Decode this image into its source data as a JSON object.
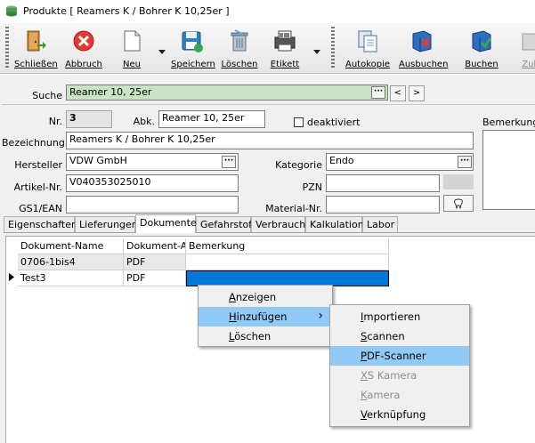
{
  "window": {
    "title": "Produkte [ Reamers K / Bohrer K 10,25er ]"
  },
  "toolbar": {
    "items": [
      {
        "label": "Schließen",
        "icon": "door-exit-icon"
      },
      {
        "label": "Abbruch",
        "icon": "cancel-icon"
      },
      {
        "label": "Neu",
        "icon": "new-document-icon"
      },
      {
        "label": "Speichern",
        "icon": "save-icon"
      },
      {
        "label": "Löschen",
        "icon": "trash-icon"
      },
      {
        "label": "Etikett",
        "icon": "label-printer-icon"
      },
      {
        "label": "Autokopie",
        "icon": "copy-icon"
      },
      {
        "label": "Ausbuchen",
        "icon": "book-out-icon"
      },
      {
        "label": "Buchen",
        "icon": "book-in-icon"
      },
      {
        "label": "Zub",
        "icon": "accessories-icon"
      }
    ]
  },
  "form": {
    "search_label": "Suche",
    "search_value": "Reamer 10, 25er",
    "nr_label": "Nr.",
    "nr_value": "3",
    "abk_label": "Abk.",
    "abk_value": "Reamer 10, 25er",
    "deaktiviert_label": "deaktiviert",
    "deaktiviert_checked": false,
    "bemerkung_label": "Bemerkung",
    "bezeichnung_label": "Bezeichnung",
    "bezeichnung_value": "Reamers K / Bohrer K 10,25er",
    "hersteller_label": "Hersteller",
    "hersteller_value": "VDW GmbH",
    "kategorie_label": "Kategorie",
    "kategorie_value": "Endo",
    "artikel_label": "Artikel-Nr.",
    "artikel_value": "V040353025010",
    "pzn_label": "PZN",
    "pzn_value": "",
    "gs1_label": "GS1/EAN",
    "gs1_value": "",
    "material_label": "Material-Nr.",
    "material_value": "",
    "dots": "···",
    "prev": "<",
    "next": ">"
  },
  "tabs": [
    {
      "label": "Eigenschaften",
      "active": false
    },
    {
      "label": "Lieferungen",
      "active": false
    },
    {
      "label": "Dokumente",
      "active": true
    },
    {
      "label": "Gefahrstoff",
      "active": false
    },
    {
      "label": "Verbrauch",
      "active": false
    },
    {
      "label": "Kalkulation",
      "active": false
    },
    {
      "label": "Labor",
      "active": false
    }
  ],
  "grid": {
    "columns": [
      "Dokument-Name",
      "Dokument-Art",
      "Bemerkung"
    ],
    "rows": [
      {
        "name": "0706-1bis4",
        "art": "PDF",
        "bemerkung": ""
      },
      {
        "name": "Test3",
        "art": "PDF",
        "bemerkung": ""
      }
    ]
  },
  "context_menu": {
    "items": [
      {
        "label": "Anzeigen",
        "underline": "A",
        "rest": "nzeigen"
      },
      {
        "label": "Hinzufügen",
        "underline": "H",
        "rest": "inzufügen",
        "submenu_arrow": "›"
      },
      {
        "label": "Löschen",
        "underline": "L",
        "rest": "öschen"
      }
    ]
  },
  "submenu": {
    "items": [
      {
        "label": "Importieren",
        "underline": "I",
        "rest": "mportieren",
        "disabled": false
      },
      {
        "label": "Scannen",
        "underline": "S",
        "rest": "cannen",
        "disabled": false
      },
      {
        "label": "PDF-Scanner",
        "underline": "P",
        "rest": "DF-Scanner",
        "disabled": false
      },
      {
        "label": "XS Kamera",
        "underline": "X",
        "rest": "S Kamera",
        "disabled": true
      },
      {
        "label": "Kamera",
        "underline": "K",
        "rest": "amera",
        "disabled": true
      },
      {
        "label": "Verknüpfung",
        "underline": "V",
        "rest": "erknüpfung",
        "disabled": false
      }
    ]
  },
  "colors": {
    "selection": "#0078d7",
    "menu_highlight": "#91c9f7",
    "search_bg": "#c9e3c3"
  }
}
